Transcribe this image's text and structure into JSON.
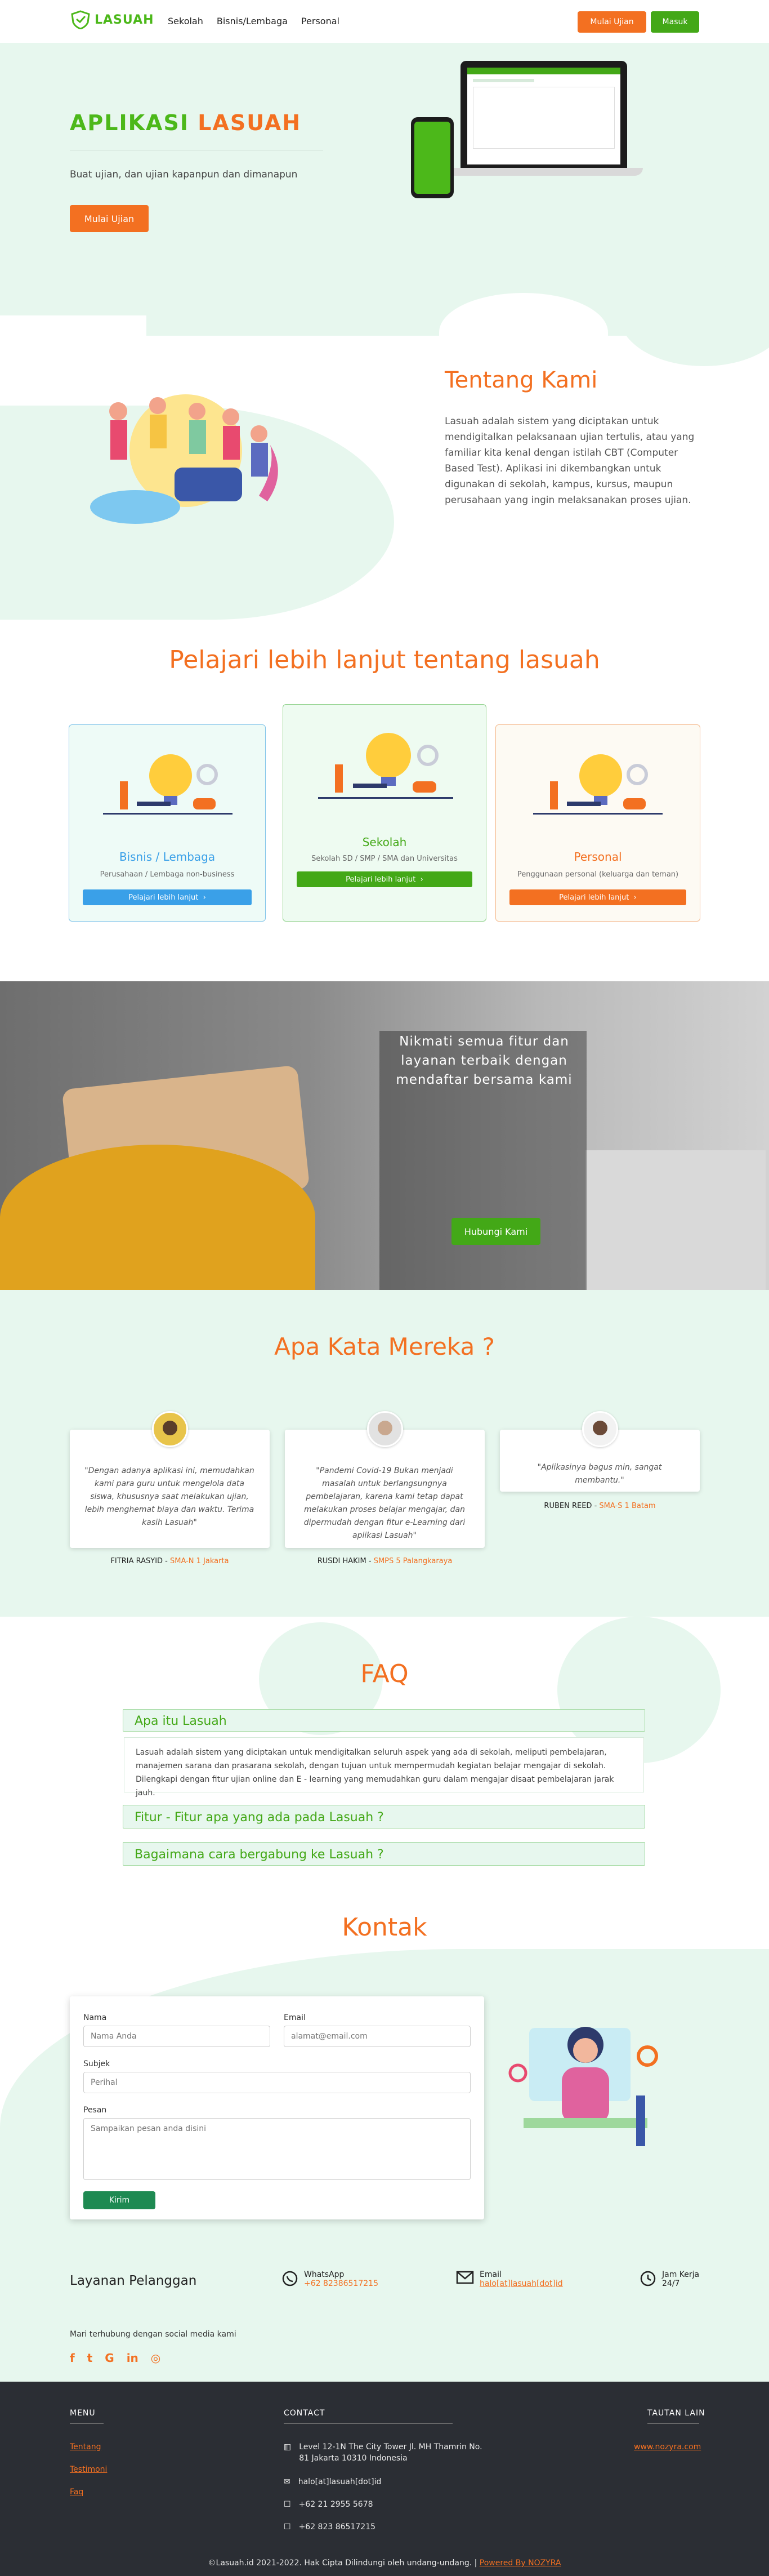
{
  "nav": {
    "brand": "LASUAH",
    "links": [
      "Sekolah",
      "Bisnis/Lembaga",
      "Personal"
    ],
    "exam_button": "Mulai Ujian",
    "login_button": "Masuk"
  },
  "hero": {
    "title_green": "APLIKASI",
    "title_orange": "LASUAH",
    "subtitle": "Buat ujian, dan ujian kapanpun dan dimanapun",
    "cta": "Mulai Ujian"
  },
  "about": {
    "title": "Tentang Kami",
    "text": "Lasuah adalah sistem yang diciptakan untuk mendigitalkan pelaksanaan ujian tertulis, atau yang familiar kita kenal dengan istilah CBT (Computer Based Test). Aplikasi ini dikembangkan untuk digunakan di sekolah, kampus, kursus, maupun perusahaan yang ingin melaksanakan proses ujian."
  },
  "learn": {
    "title": "Pelajari lebih lanjut tentang lasuah",
    "cards": [
      {
        "title": "Bisnis / Lembaga",
        "desc": "Perusahaan / Lembaga non-business",
        "button": "Pelajari lebih lanjut",
        "color": "#3aa0e8"
      },
      {
        "title": "Sekolah",
        "desc": "Sekolah SD / SMP / SMA dan Universitas",
        "button": "Pelajari lebih lanjut",
        "color": "#43a817"
      },
      {
        "title": "Personal",
        "desc": "Penggunaan personal (keluarga dan teman)",
        "button": "Pelajari lebih lanjut",
        "color": "#f37021"
      }
    ]
  },
  "banner": {
    "text": "Nikmati semua fitur dan layanan terbaik dengan mendaftar bersama kami",
    "button": "Hubungi Kami"
  },
  "testimonials": {
    "title": "Apa Kata Mereka ?",
    "items": [
      {
        "quote": "\"Dengan adanya aplikasi ini, memudahkan kami para guru untuk mengelola data siswa, khususnya saat melakukan ujian, lebih menghemat biaya dan waktu. Terima kasih Lasuah\"",
        "name": "FITRIA RASYID",
        "sep": " - ",
        "institution": "SMA-N 1 Jakarta"
      },
      {
        "quote": "\"Pandemi Covid-19 Bukan menjadi masalah untuk berlangsungnya pembelajaran, karena kami tetap dapat melakukan proses belajar mengajar, dan dipermudah dengan fitur e-Learning dari aplikasi Lasuah\"",
        "name": "RUSDI HAKIM",
        "sep": " - ",
        "institution": "SMPS 5 Palangkaraya"
      },
      {
        "quote": "\"Aplikasinya bagus min, sangat membantu.\"",
        "name": "RUBEN REED",
        "sep": " - ",
        "institution": "SMA-S 1 Batam"
      }
    ]
  },
  "faq": {
    "title": "FAQ",
    "items": [
      {
        "q": "Apa itu Lasuah",
        "a": "Lasuah adalah sistem yang diciptakan untuk mendigitalkan seluruh aspek yang ada di sekolah, meliputi pembelajaran, manajemen sarana dan prasarana sekolah, dengan tujuan untuk mempermudah kegiatan belajar mengajar di sekolah. Dilengkapi dengan fitur ujian online dan E - learning yang memudahkan guru dalam mengajar disaat pembelajaran jarak jauh."
      },
      {
        "q": "Fitur - Fitur apa yang ada pada Lasuah ?"
      },
      {
        "q": "Bagaimana cara bergabung ke Lasuah ?"
      }
    ]
  },
  "contact": {
    "title": "Kontak",
    "name_label": "Nama",
    "name_placeholder": "Nama Anda",
    "email_label": "Email",
    "email_placeholder": "alamat@email.com",
    "subject_label": "Subjek",
    "subject_placeholder": "Perihal",
    "message_label": "Pesan",
    "message_placeholder": "Sampaikan pesan anda disini",
    "submit": "Kirim"
  },
  "service": {
    "title": "Layanan Pelanggan",
    "whatsapp_label": "WhatsApp",
    "whatsapp_value": "+62 82386517215",
    "email_label": "Email",
    "email_value": "halo[at]lasuah[dot]id",
    "hours_label": "Jam Kerja",
    "hours_value": "24/7",
    "social_label": "Mari terhubung dengan social media kami",
    "social_icons": [
      "facebook-icon",
      "twitter-icon",
      "google-icon",
      "linkedin-icon",
      "instagram-icon"
    ]
  },
  "footer": {
    "menu_title": "MENU",
    "menu_items": [
      "Tentang",
      "Testimoni",
      "Faq"
    ],
    "contact_title": "CONTACT",
    "address": "Level 12-1N The City Tower Jl. MH Thamrin No. 81 Jakarta 10310 Indonesia",
    "email": "halo[at]lasuah[dot]id",
    "phone1": "+62 21 2955 5678",
    "phone2": "+62 823 86517215",
    "other_title": "TAUTAN LAIN",
    "other_link": "www.nozyra.com",
    "copyright": "©Lasuah.id 2021-2022. Hak Cipta Dilindungi oleh undang-undang. | ",
    "powered": "Powered By NOZYRA"
  }
}
